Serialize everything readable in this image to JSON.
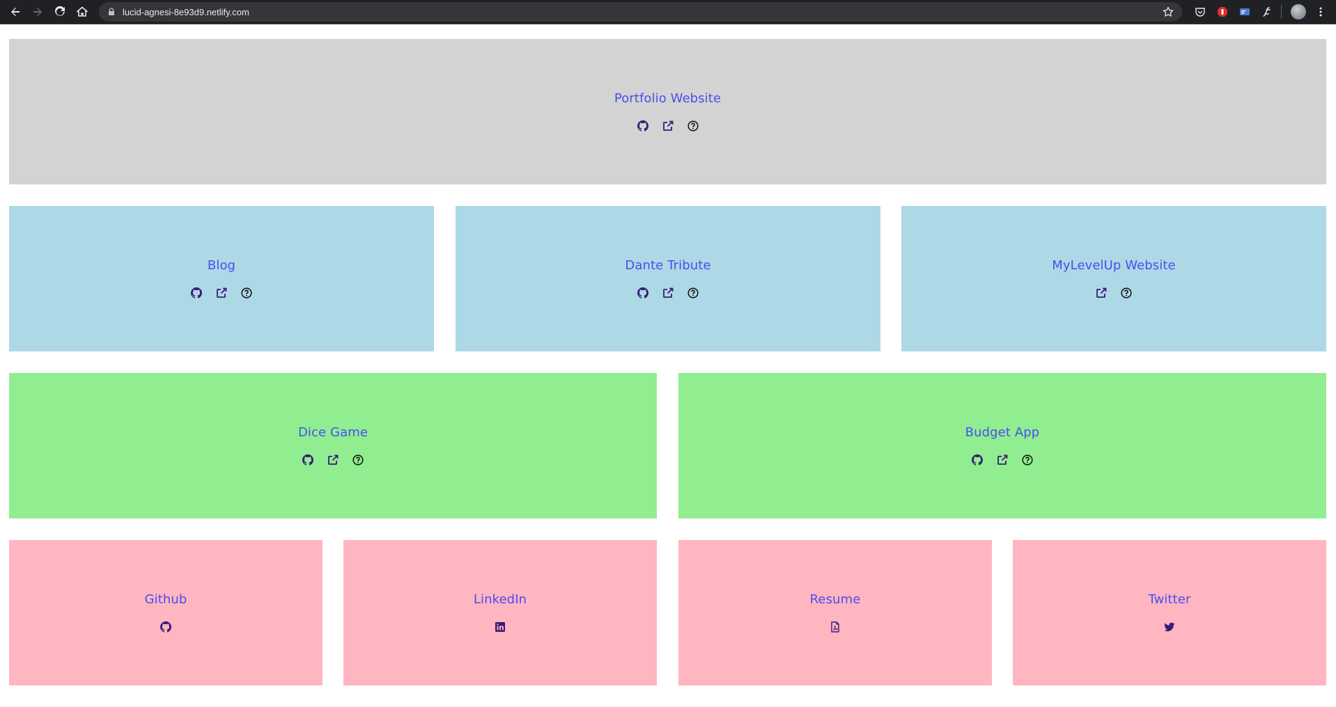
{
  "browser": {
    "url": "lucid-agnesi-8e93d9.netlify.com"
  },
  "projects": {
    "portfolio": {
      "title": "Portfolio Website"
    },
    "blog": {
      "title": "Blog"
    },
    "dante": {
      "title": "Dante Tribute"
    },
    "mylevelup": {
      "title": "MyLevelUp Website"
    },
    "dice": {
      "title": "Dice Game"
    },
    "budget": {
      "title": "Budget App"
    }
  },
  "links": {
    "github": {
      "title": "Github"
    },
    "linkedin": {
      "title": "LinkedIn"
    },
    "resume": {
      "title": "Resume"
    },
    "twitter": {
      "title": "Twitter"
    }
  },
  "colors": {
    "grey": "#d3d3d3",
    "blue": "#add8e6",
    "green": "#90ee90",
    "pink": "#ffb6c1",
    "title": "#4c4cf0",
    "icon": "#3a1a78"
  },
  "icons": [
    "github-icon",
    "external-link-icon",
    "help-icon",
    "linkedin-icon",
    "pdf-icon",
    "twitter-icon"
  ]
}
